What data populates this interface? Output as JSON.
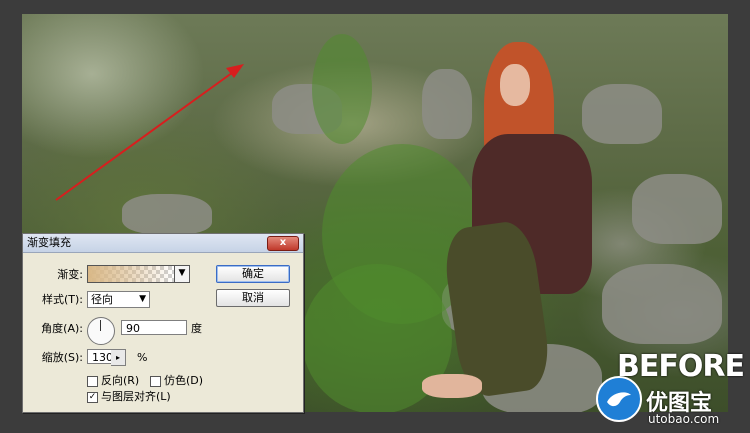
{
  "dialog": {
    "title": "渐变填充",
    "close_label": "x",
    "gradient_label": "渐变:",
    "style_label": "样式(T):",
    "style_value": "径向",
    "angle_label": "角度(A):",
    "angle_value": "90",
    "angle_unit": "度",
    "scale_label": "缩放(S):",
    "scale_value": "130",
    "scale_unit": "%",
    "reverse_label": "反向(R)",
    "dither_label": "仿色(D)",
    "align_label": "与图层对齐(L)",
    "ok_label": "确定",
    "cancel_label": "取消",
    "reverse_checked": false,
    "dither_checked": false,
    "align_checked": true
  },
  "watermark": {
    "before_text": "BEFORE",
    "logo_text": "优图宝",
    "logo_url": "utobao.com"
  },
  "colors": {
    "arrow": "#d81e1e",
    "gradient_start": "#d9b887",
    "logo_blue": "#1f7fd6"
  }
}
